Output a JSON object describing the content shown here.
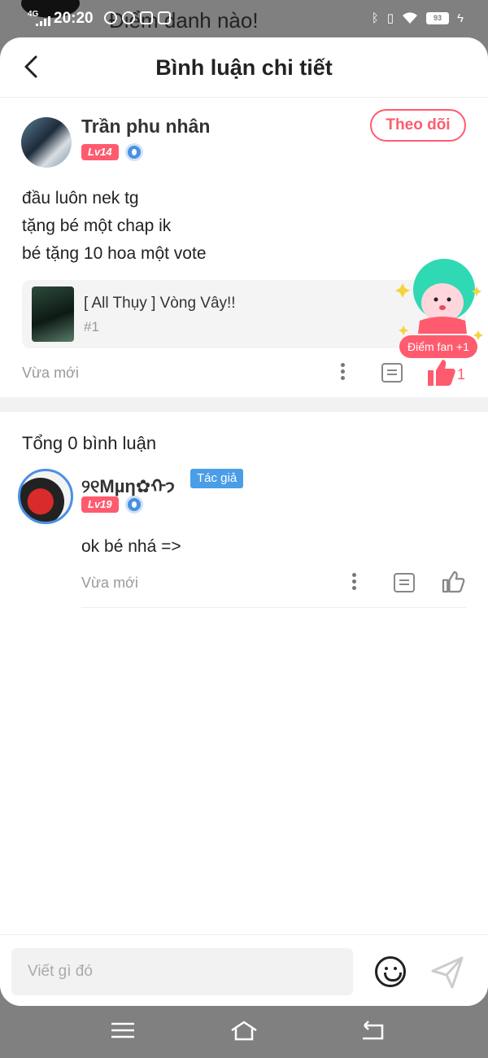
{
  "status_bar": {
    "network": "4G",
    "time": "20:20",
    "battery": "93",
    "background_text": "Điểm danh nào!"
  },
  "header": {
    "title": "Bình luận chi tiết",
    "back_icon": "chevron-left-icon"
  },
  "post": {
    "author": "Trần phu nhân",
    "level": "Lv14",
    "follow_label": "Theo dõi",
    "lines": [
      "đầu luôn nek tg",
      "tặng bé một chap ik",
      "bé tặng 10 hoa một vote"
    ],
    "book": {
      "title": "[ All Thụy ] Vòng Vây!!",
      "chapter": "#1"
    },
    "time": "Vừa mới",
    "like_count": "1",
    "fan_points": "Điểm fan +1"
  },
  "comments": {
    "total_label": "Tổng 0 bình luận",
    "items": [
      {
        "author": "୨୧Mµη✿ᡣ𐭩",
        "author_tag": "Tác giả",
        "level": "Lv19",
        "text": "ok bé nhá =>",
        "time": "Vừa mới"
      }
    ]
  },
  "input": {
    "placeholder": "Viết gì đó"
  },
  "colors": {
    "accent": "#ff5b6e",
    "author_tag": "#4a9ee8",
    "system_bar": "#808080"
  }
}
